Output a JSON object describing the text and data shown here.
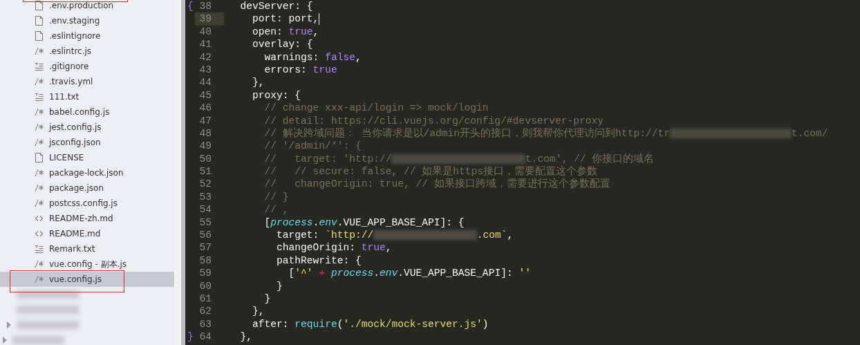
{
  "sidebar": {
    "items": [
      {
        "kind": "file",
        "name": ".env.production",
        "selected": false
      },
      {
        "kind": "file",
        "name": ".env.staging",
        "selected": false
      },
      {
        "kind": "file",
        "name": ".eslintignore",
        "selected": false
      },
      {
        "kind": "script",
        "name": ".eslintrc.js",
        "selected": false
      },
      {
        "kind": "text",
        "name": ".gitignore",
        "selected": false
      },
      {
        "kind": "script",
        "name": ".travis.yml",
        "selected": false
      },
      {
        "kind": "text",
        "name": "111.txt",
        "selected": false
      },
      {
        "kind": "script",
        "name": "babel.config.js",
        "selected": false
      },
      {
        "kind": "script",
        "name": "jest.config.js",
        "selected": false
      },
      {
        "kind": "script",
        "name": "jsconfig.json",
        "selected": false
      },
      {
        "kind": "file",
        "name": "LICENSE",
        "selected": false
      },
      {
        "kind": "script",
        "name": "package-lock.json",
        "selected": false
      },
      {
        "kind": "script",
        "name": "package.json",
        "selected": false
      },
      {
        "kind": "script",
        "name": "postcss.config.js",
        "selected": false
      },
      {
        "kind": "markup",
        "name": "README-zh.md",
        "selected": false
      },
      {
        "kind": "markup",
        "name": "README.md",
        "selected": false
      },
      {
        "kind": "text",
        "name": "Remark.txt",
        "selected": false
      },
      {
        "kind": "script",
        "name": "vue.config - 副本.js",
        "selected": false
      },
      {
        "kind": "script",
        "name": "vue.config.js",
        "selected": true,
        "outlined": true
      },
      {
        "kind": "hidden",
        "expander": false
      },
      {
        "kind": "hidden",
        "expander": false
      },
      {
        "kind": "hidden",
        "expander": true
      },
      {
        "kind": "hidden-root",
        "expander": true
      }
    ]
  },
  "frame_above_sidebar": true,
  "editor": {
    "lines": [
      {
        "number": "38",
        "current": false,
        "fold": "{",
        "tokens": [
          {
            "kind": "plain",
            "text": "  devServer: {"
          }
        ]
      },
      {
        "number": "39",
        "current": true,
        "tokens": [
          {
            "kind": "plain",
            "text": "    port: port,"
          }
        ]
      },
      {
        "number": "40",
        "current": false,
        "tokens": [
          {
            "kind": "plain",
            "text": "    open: "
          },
          {
            "kind": "const",
            "text": "true"
          },
          {
            "kind": "plain",
            "text": ","
          }
        ]
      },
      {
        "number": "41",
        "current": false,
        "tokens": [
          {
            "kind": "plain",
            "text": "    overlay: {"
          }
        ]
      },
      {
        "number": "42",
        "current": false,
        "tokens": [
          {
            "kind": "plain",
            "text": "      warnings: "
          },
          {
            "kind": "const",
            "text": "false"
          },
          {
            "kind": "plain",
            "text": ","
          }
        ]
      },
      {
        "number": "43",
        "current": false,
        "tokens": [
          {
            "kind": "plain",
            "text": "      errors: "
          },
          {
            "kind": "const",
            "text": "true"
          }
        ]
      },
      {
        "number": "44",
        "current": false,
        "tokens": [
          {
            "kind": "plain",
            "text": "    },"
          }
        ]
      },
      {
        "number": "45",
        "current": false,
        "tokens": [
          {
            "kind": "plain",
            "text": "    proxy: {"
          }
        ]
      },
      {
        "number": "46",
        "current": false,
        "tokens": [
          {
            "kind": "comment",
            "text": "      // change xxx-api/login => mock/login"
          }
        ]
      },
      {
        "number": "47",
        "current": false,
        "tokens": [
          {
            "kind": "comment",
            "text": "      // detail: https://cli.vuejs.org/config/#devserver-proxy"
          }
        ]
      },
      {
        "number": "48",
        "current": false,
        "tokens": [
          {
            "kind": "comment",
            "text": "      // 解决跨域问题： 当你请求是以/admin开头的接口，则我帮你代理访问到http://tr"
          },
          {
            "kind": "redacted"
          },
          {
            "kind": "comment",
            "text": "t.com/"
          }
        ]
      },
      {
        "number": "49",
        "current": false,
        "tokens": [
          {
            "kind": "comment",
            "text": "      // '/admin/*': {"
          }
        ]
      },
      {
        "number": "50",
        "current": false,
        "tokens": [
          {
            "kind": "comment",
            "text": "      //   target: 'http://"
          },
          {
            "kind": "redacted"
          },
          {
            "kind": "comment",
            "text": "t.com', // 你接口的域名"
          }
        ]
      },
      {
        "number": "51",
        "current": false,
        "tokens": [
          {
            "kind": "comment",
            "text": "      //   // secure: false, // 如果是https接口，需要配置这个参数"
          }
        ]
      },
      {
        "number": "52",
        "current": false,
        "tokens": [
          {
            "kind": "comment",
            "text": "      //   changeOrigin: true, // 如果接口跨域，需要进行这个参数配置"
          }
        ]
      },
      {
        "number": "53",
        "current": false,
        "tokens": [
          {
            "kind": "comment",
            "text": "      // }"
          }
        ]
      },
      {
        "number": "54",
        "current": false,
        "tokens": [
          {
            "kind": "comment",
            "text": "      // ,"
          }
        ]
      },
      {
        "number": "55",
        "current": false,
        "tokens": [
          {
            "kind": "plain",
            "text": "      ["
          },
          {
            "kind": "object",
            "text": "process"
          },
          {
            "kind": "plain",
            "text": "."
          },
          {
            "kind": "object",
            "text": "env"
          },
          {
            "kind": "plain",
            "text": ".VUE_APP_BASE_API]: {"
          }
        ]
      },
      {
        "number": "56",
        "current": false,
        "tokens": [
          {
            "kind": "plain",
            "text": "        target: "
          },
          {
            "kind": "string",
            "text": "`http://"
          },
          {
            "kind": "redacted"
          },
          {
            "kind": "string",
            "text": ".com`"
          },
          {
            "kind": "plain",
            "text": ","
          }
        ]
      },
      {
        "number": "57",
        "current": false,
        "tokens": [
          {
            "kind": "plain",
            "text": "        changeOrigin: "
          },
          {
            "kind": "const",
            "text": "true"
          },
          {
            "kind": "plain",
            "text": ","
          }
        ]
      },
      {
        "number": "58",
        "current": false,
        "tokens": [
          {
            "kind": "plain",
            "text": "        pathRewrite: {"
          }
        ]
      },
      {
        "number": "59",
        "current": false,
        "tokens": [
          {
            "kind": "plain",
            "text": "          ["
          },
          {
            "kind": "string",
            "text": "'^'"
          },
          {
            "kind": "operator",
            "text": " + "
          },
          {
            "kind": "object",
            "text": "process"
          },
          {
            "kind": "plain",
            "text": "."
          },
          {
            "kind": "object",
            "text": "env"
          },
          {
            "kind": "plain",
            "text": ".VUE_APP_BASE_API]: "
          },
          {
            "kind": "string",
            "text": "''"
          }
        ]
      },
      {
        "number": "60",
        "current": false,
        "tokens": [
          {
            "kind": "plain",
            "text": "        }"
          }
        ]
      },
      {
        "number": "61",
        "current": false,
        "tokens": [
          {
            "kind": "plain",
            "text": "      }"
          }
        ]
      },
      {
        "number": "62",
        "current": false,
        "tokens": [
          {
            "kind": "plain",
            "text": "    },"
          }
        ]
      },
      {
        "number": "63",
        "current": false,
        "tokens": [
          {
            "kind": "plain",
            "text": "    after: "
          },
          {
            "kind": "function",
            "text": "require"
          },
          {
            "kind": "plain",
            "text": "("
          },
          {
            "kind": "string",
            "text": "'./mock/mock-server.js'"
          },
          {
            "kind": "plain",
            "text": ")"
          }
        ]
      },
      {
        "number": "64",
        "current": false,
        "fold": "}",
        "tokens": [
          {
            "kind": "plain",
            "text": "  },"
          }
        ]
      }
    ]
  }
}
